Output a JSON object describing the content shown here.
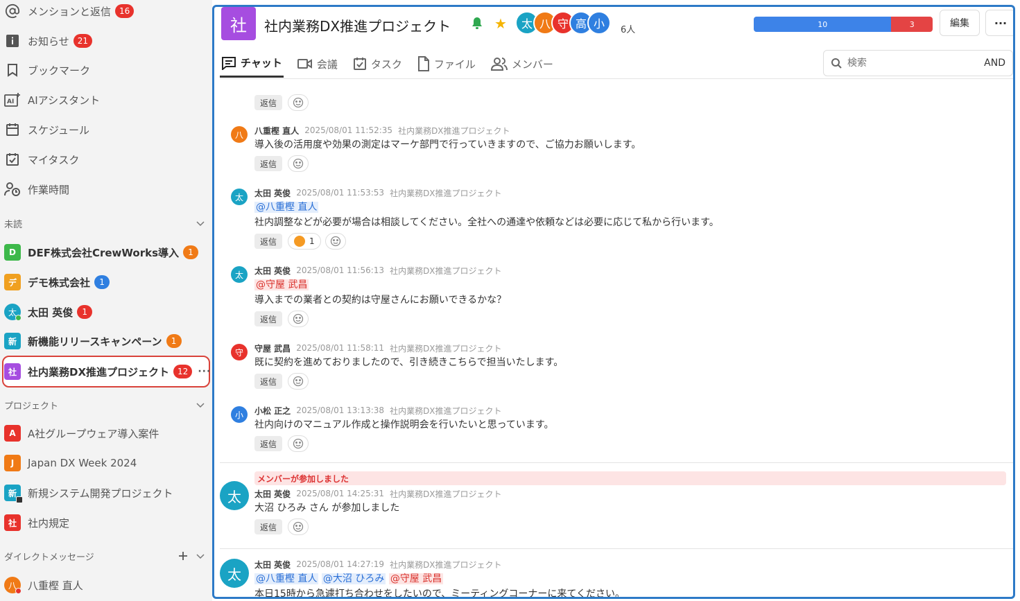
{
  "sidebar": {
    "nav": [
      {
        "label": "メンションと返信",
        "badge": "16",
        "icon": "at-icon"
      },
      {
        "label": "お知らせ",
        "badge": "21",
        "icon": "info-icon"
      },
      {
        "label": "ブックマーク",
        "icon": "bookmark-icon"
      },
      {
        "label": "AIアシスタント",
        "icon": "ai-icon"
      },
      {
        "label": "スケジュール",
        "icon": "calendar-icon"
      },
      {
        "label": "マイタスク",
        "icon": "task-check-icon"
      },
      {
        "label": "作業時間",
        "icon": "worktime-icon"
      }
    ],
    "unread_section": "未読",
    "unread": [
      {
        "label": "DEF株式会社CrewWorks導入",
        "avatar": "D",
        "badge": "1",
        "color": "#3db84a"
      },
      {
        "label": "デモ株式会社",
        "avatar": "デ",
        "badge": "1",
        "color": "#f0a020"
      },
      {
        "label": "太田 英俊",
        "avatar": "太",
        "badge": "1",
        "color": "#1aa3c4"
      },
      {
        "label": "新機能リリースキャンペーン",
        "avatar": "新",
        "badge": "1",
        "color": "#1aa3c4"
      },
      {
        "label": "社内業務DX推進プロジェクト",
        "avatar": "社",
        "badge": "12",
        "color": "#a64de0"
      }
    ],
    "more": "···",
    "project_section": "プロジェクト",
    "projects": [
      {
        "label": "A社グループウェア導入案件",
        "avatar": "A",
        "color": "#e8322c"
      },
      {
        "label": "Japan DX Week 2024",
        "avatar": "J",
        "color": "#f07a16"
      },
      {
        "label": "新規システム開発プロジェクト",
        "avatar": "新",
        "color": "#1aa3c4"
      },
      {
        "label": "社内規定",
        "avatar": "社",
        "color": "#e8322c"
      }
    ],
    "dm_section": "ダイレクトメッセージ",
    "dm": [
      {
        "label": "八重樫 直人",
        "avatar": "八",
        "color": "#f07a16"
      }
    ]
  },
  "channel": {
    "icon": "社",
    "title": "社内業務DX推進プロジェクト",
    "members": [
      {
        "initial": "太",
        "color": "#1aa3c4"
      },
      {
        "initial": "八",
        "color": "#f07a16"
      },
      {
        "initial": "守",
        "color": "#e8322c"
      },
      {
        "initial": "高",
        "color": "#2f7fe0"
      },
      {
        "initial": "小",
        "color": "#2f7fe0"
      }
    ],
    "member_count": "6人",
    "task_done": "10",
    "task_overdue": "3",
    "edit_label": "編集",
    "more_label": "···"
  },
  "tabs": [
    {
      "label": "チャット",
      "icon": "chat-icon"
    },
    {
      "label": "会議",
      "icon": "video-icon"
    },
    {
      "label": "タスク",
      "icon": "task-icon"
    },
    {
      "label": "ファイル",
      "icon": "file-icon"
    },
    {
      "label": "メンバー",
      "icon": "members-icon"
    }
  ],
  "search": {
    "placeholder": "検索",
    "mode": "AND"
  },
  "messages": {
    "reply_label": "返信",
    "m1": {
      "name": "八重樫 直人",
      "avatar": "八",
      "color": "#f07a16",
      "time": "2025/08/01 11:52:35",
      "channel": "社内業務DX推進プロジェクト",
      "text": "導入後の活用度や効果の測定はマーケ部門で行っていきますので、ご協力お願いします。"
    },
    "m2": {
      "name": "太田 英俊",
      "avatar": "太",
      "color": "#1aa3c4",
      "time": "2025/08/01 11:53:53",
      "channel": "社内業務DX推進プロジェクト",
      "mention": "@八重樫 直人",
      "text": "社内調整などが必要が場合は相談してください。全社への通達や依頼などは必要に応じて私から行います。",
      "reaction_count": "1"
    },
    "m3": {
      "name": "太田 英俊",
      "avatar": "太",
      "color": "#1aa3c4",
      "time": "2025/08/01 11:56:13",
      "channel": "社内業務DX推進プロジェクト",
      "mention": "@守屋 武昌",
      "text": "導入までの業者との契約は守屋さんにお願いできるかな？"
    },
    "m4": {
      "name": "守屋 武昌",
      "avatar": "守",
      "color": "#e8322c",
      "time": "2025/08/01 11:58:11",
      "channel": "社内業務DX推進プロジェクト",
      "text": "既に契約を進めておりましたので、引き続きこちらで担当いたします。"
    },
    "m5": {
      "name": "小松 正之",
      "avatar": "小",
      "color": "#2f7fe0",
      "time": "2025/08/01 13:13:38",
      "channel": "社内業務DX推進プロジェクト",
      "text": "社内向けのマニュアル作成と操作説明会を行いたいと思っています。"
    },
    "m6": {
      "system": "メンバーが参加しました",
      "name": "太田 英俊",
      "avatar": "太",
      "color": "#1aa3c4",
      "time": "2025/08/01 14:25:31",
      "channel": "社内業務DX推進プロジェクト",
      "text": "大沼 ひろみ さん が参加しました"
    },
    "m7": {
      "name": "太田 英俊",
      "avatar": "太",
      "color": "#1aa3c4",
      "time": "2025/08/01 14:27:19",
      "channel": "社内業務DX推進プロジェクト",
      "mention1": "@八重樫 直人",
      "mention2": "@大沼 ひろみ",
      "mention3": "@守屋 武昌",
      "text": "本日15時から急遽打ち合わせをしたいので、ミーティングコーナーに来てください。"
    }
  }
}
